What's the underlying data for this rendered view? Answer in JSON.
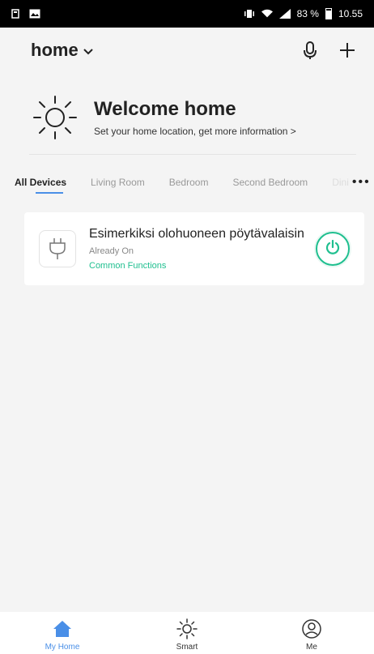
{
  "status_bar": {
    "battery_percent": "83 %",
    "time": "10.55"
  },
  "header": {
    "home_label": "home",
    "chevron_icon": "chevron-down-icon",
    "mic_icon": "microphone-icon",
    "add_icon": "plus-icon"
  },
  "welcome": {
    "title": "Welcome home",
    "subtitle": "Set your home location, get more information >"
  },
  "tabs": {
    "items": [
      "All Devices",
      "Living Room",
      "Bedroom",
      "Second Bedroom",
      "Dini"
    ],
    "active_index": 0,
    "more_icon": "more-dots-icon"
  },
  "device": {
    "name": "Esimerkiksi olohuoneen pöytävalaisin",
    "status": "Already On",
    "link": "Common Functions",
    "icon": "plug-icon",
    "power_icon": "power-icon"
  },
  "bottom_nav": {
    "items": [
      {
        "label": "My Home",
        "icon": "home-icon"
      },
      {
        "label": "Smart",
        "icon": "sun-icon"
      },
      {
        "label": "Me",
        "icon": "user-icon"
      }
    ],
    "active_index": 0
  },
  "colors": {
    "accent_blue": "#4a8fe7",
    "accent_green": "#1fbf8f"
  }
}
